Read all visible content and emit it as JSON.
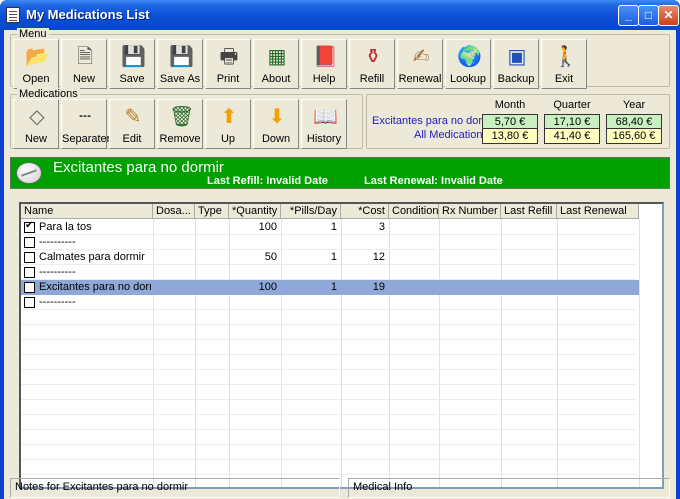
{
  "window": {
    "title": "My Medications List"
  },
  "menu_group": {
    "label": "Menu",
    "buttons": [
      {
        "label": "Open",
        "icon": "folder-open-icon"
      },
      {
        "label": "New",
        "icon": "new-document-icon"
      },
      {
        "label": "Save",
        "icon": "save-disk-icon"
      },
      {
        "label": "Save As",
        "icon": "save-as-icon"
      },
      {
        "label": "Print",
        "icon": "printer-icon"
      },
      {
        "label": "About",
        "icon": "about-icon"
      },
      {
        "label": "Help",
        "icon": "help-book-icon"
      },
      {
        "label": "Refill",
        "icon": "pill-bottle-icon"
      },
      {
        "label": "Renewal",
        "icon": "renewal-icon"
      },
      {
        "label": "Lookup",
        "icon": "globe-icon"
      },
      {
        "label": "Backup",
        "icon": "backup-icon"
      },
      {
        "label": "Exit",
        "icon": "exit-icon"
      }
    ]
  },
  "medications_group": {
    "label": "Medications",
    "buttons": [
      {
        "label": "New",
        "icon": "new-medication-icon"
      },
      {
        "label": "Separater",
        "icon": "separator-icon"
      },
      {
        "label": "Edit",
        "icon": "edit-pencil-icon"
      },
      {
        "label": "Remove",
        "icon": "trash-icon"
      },
      {
        "label": "Up",
        "icon": "arrow-up-icon"
      },
      {
        "label": "Down",
        "icon": "arrow-down-icon"
      },
      {
        "label": "History",
        "icon": "history-book-icon"
      }
    ]
  },
  "summary": {
    "headers": [
      "Month",
      "Quarter",
      "Year"
    ],
    "selected_label": "Excitantes para no dormir",
    "selected_values": [
      "5,70 €",
      "17,10 €",
      "68,40 €"
    ],
    "all_label": "All Medications",
    "all_values": [
      "13,80 €",
      "41,40 €",
      "165,60 €"
    ]
  },
  "banner": {
    "title": "Excitantes para no dormir",
    "last_refill": "Last Refill: Invalid Date",
    "last_renewal": "Last Renewal: Invalid Date"
  },
  "table": {
    "columns": [
      "Name",
      "Dosa...",
      "Type",
      "*Quantity",
      "*Pills/Day",
      "*Cost",
      "Condition",
      "Rx Number",
      "Last Refill",
      "Last Renewal"
    ],
    "rows": [
      {
        "checked": true,
        "name": "Para la tos",
        "quantity": "100",
        "pills": "1",
        "cost": "3",
        "selected": false
      },
      {
        "checked": false,
        "name": "----------",
        "quantity": "",
        "pills": "",
        "cost": "",
        "selected": false
      },
      {
        "checked": false,
        "name": "Calmates para dormir",
        "quantity": "50",
        "pills": "1",
        "cost": "12",
        "selected": false
      },
      {
        "checked": false,
        "name": "----------",
        "quantity": "",
        "pills": "",
        "cost": "",
        "selected": false
      },
      {
        "checked": false,
        "name": "Excitantes para no dormir",
        "quantity": "100",
        "pills": "1",
        "cost": "19",
        "selected": true
      },
      {
        "checked": false,
        "name": "----------",
        "quantity": "",
        "pills": "",
        "cost": "",
        "selected": false
      }
    ]
  },
  "status": {
    "notes": "Notes for Excitantes para no dormir",
    "medical": "Medical Info"
  },
  "colors": {
    "banner": "#00a000",
    "selection": "#8ea9d8",
    "title_bar": "#0a4fd8"
  }
}
